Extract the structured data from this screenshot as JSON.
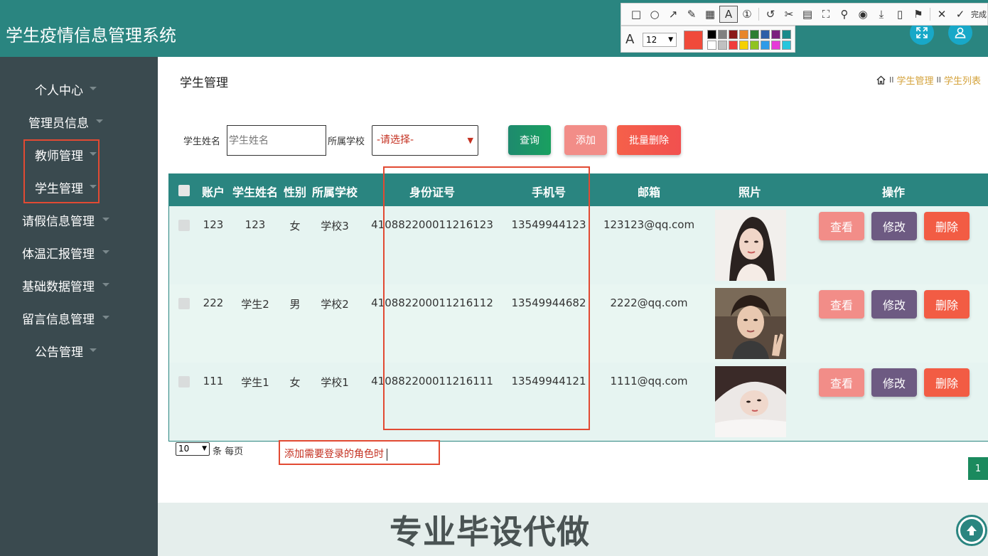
{
  "header": {
    "title": "学生疫情信息管理系统",
    "buttons": [
      {
        "icon": "fullscreen-icon"
      },
      {
        "icon": "user-icon"
      }
    ]
  },
  "annotation_toolbar": {
    "tools": [
      {
        "icon": "rectangle-icon",
        "glyph": "□"
      },
      {
        "icon": "ellipse-icon",
        "glyph": "○"
      },
      {
        "icon": "arrow-icon",
        "glyph": "↗"
      },
      {
        "icon": "pen-icon",
        "glyph": "✎"
      },
      {
        "icon": "mosaic-icon",
        "glyph": "▦"
      },
      {
        "icon": "text-icon",
        "glyph": "A"
      },
      {
        "icon": "number-icon",
        "glyph": "①"
      },
      {
        "icon": "undo-icon",
        "glyph": "↺"
      },
      {
        "icon": "scissors-icon",
        "glyph": "✂"
      },
      {
        "icon": "ocr-icon",
        "glyph": "▤"
      },
      {
        "icon": "capture-icon",
        "glyph": "⛶"
      },
      {
        "icon": "pin-icon",
        "glyph": "⚲"
      },
      {
        "icon": "record-icon",
        "glyph": "◉"
      },
      {
        "icon": "download-icon",
        "glyph": "⤓"
      },
      {
        "icon": "phone-icon",
        "glyph": "▯"
      },
      {
        "icon": "bookmark-icon",
        "glyph": "⚑"
      },
      {
        "icon": "close-icon",
        "glyph": "✕"
      },
      {
        "icon": "check-icon",
        "glyph": "✓"
      }
    ],
    "done_label": "完成",
    "font_size": "12",
    "current_color": "#f04a3a",
    "palette": [
      "#000000",
      "#808080",
      "#8b1a1a",
      "#e8862a",
      "#2e7d32",
      "#2d5fa8",
      "#7b1f7e",
      "#1a8a8a",
      "#ffffff",
      "#c0c0c0",
      "#f03c3c",
      "#f5d000",
      "#8fc31f",
      "#2f9be8",
      "#e63ad8",
      "#25c6dc"
    ]
  },
  "sidebar": {
    "items": [
      {
        "label": "个人中心"
      },
      {
        "label": "管理员信息"
      },
      {
        "label": "教师管理"
      },
      {
        "label": "学生管理"
      },
      {
        "label": "请假信息管理"
      },
      {
        "label": "体温汇报管理"
      },
      {
        "label": "基础数据管理"
      },
      {
        "label": "留言信息管理"
      },
      {
        "label": "公告管理"
      }
    ]
  },
  "page": {
    "title": "学生管理",
    "breadcrumb": [
      "学生管理",
      "学生列表"
    ],
    "breadcrumb_sep": "II"
  },
  "search": {
    "name_label": "学生姓名",
    "name_placeholder": "学生姓名",
    "school_label": "所属学校",
    "school_value": "-请选择-",
    "query_button": "查询",
    "add_button": "添加",
    "batch_delete_button": "批量删除"
  },
  "table": {
    "columns": [
      "账户",
      "学生姓名",
      "性别",
      "所属学校",
      "身份证号",
      "手机号",
      "邮箱",
      "照片",
      "操作"
    ],
    "rows": [
      {
        "account": "123",
        "name": "123",
        "gender": "女",
        "school": "学校3",
        "id_number": "410882200011216123",
        "phone": "13549944123",
        "email": "123123@qq.com"
      },
      {
        "account": "222",
        "name": "学生2",
        "gender": "男",
        "school": "学校2",
        "id_number": "410882200011216112",
        "phone": "13549944682",
        "email": "2222@qq.com"
      },
      {
        "account": "111",
        "name": "学生1",
        "gender": "女",
        "school": "学校1",
        "id_number": "410882200011216111",
        "phone": "13549944121",
        "email": "1111@qq.com"
      }
    ],
    "actions": {
      "view": "查看",
      "edit": "修改",
      "delete": "删除"
    }
  },
  "pagination": {
    "per_page": "10",
    "per_page_label": "条 每页",
    "current_page": "1"
  },
  "annotation": {
    "text": "添加需要登录的角色时"
  },
  "footer": {
    "watermark": "专业毕设代做"
  }
}
